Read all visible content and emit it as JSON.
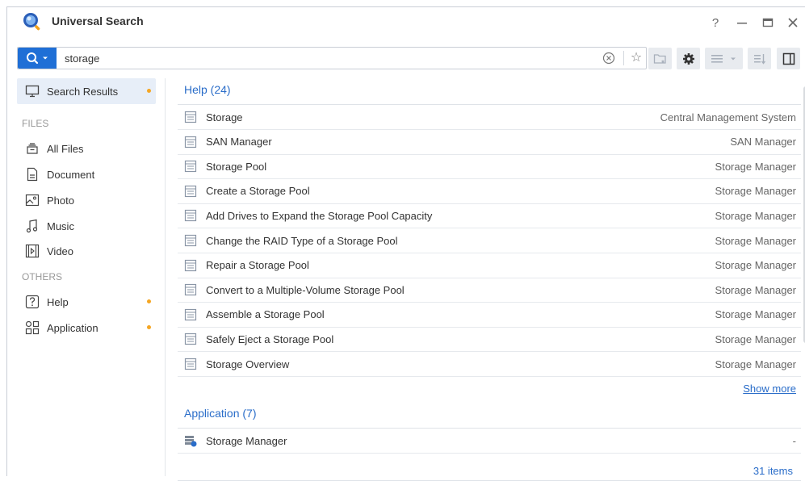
{
  "window": {
    "title": "Universal Search",
    "controls": [
      "help",
      "minimize",
      "maximize",
      "close"
    ],
    "help_glyph": "?"
  },
  "search": {
    "value": "storage",
    "placeholder": "",
    "button_icon": "search-icon"
  },
  "toolbar": {
    "buttons": [
      "folder-star-icon",
      "gear-icon",
      "list-view-icon",
      "sort-icon",
      "panel-toggle-icon"
    ]
  },
  "sidebar": {
    "active": "Search Results",
    "items": [
      {
        "label": "Search Results",
        "icon": "monitor-icon",
        "dot": true
      },
      {
        "label": "All Files",
        "icon": "files-icon",
        "dot": false
      },
      {
        "label": "Document",
        "icon": "document-icon",
        "dot": false
      },
      {
        "label": "Photo",
        "icon": "photo-icon",
        "dot": false
      },
      {
        "label": "Music",
        "icon": "music-icon",
        "dot": false
      },
      {
        "label": "Video",
        "icon": "video-icon",
        "dot": false
      },
      {
        "label": "Help",
        "icon": "help-icon",
        "dot": true
      },
      {
        "label": "Application",
        "icon": "apps-icon",
        "dot": true
      }
    ],
    "sections": {
      "files": "FILES",
      "others": "OTHERS"
    }
  },
  "results": {
    "help": {
      "title": "Help (24)",
      "rows": [
        {
          "name": "Storage",
          "source": "Central Management System"
        },
        {
          "name": "SAN Manager",
          "source": "SAN Manager"
        },
        {
          "name": "Storage Pool",
          "source": "Storage Manager"
        },
        {
          "name": "Create a Storage Pool",
          "source": "Storage Manager"
        },
        {
          "name": "Add Drives to Expand the Storage Pool Capacity",
          "source": "Storage Manager"
        },
        {
          "name": "Change the RAID Type of a Storage Pool",
          "source": "Storage Manager"
        },
        {
          "name": "Repair a Storage Pool",
          "source": "Storage Manager"
        },
        {
          "name": "Convert to a Multiple-Volume Storage Pool",
          "source": "Storage Manager"
        },
        {
          "name": "Assemble a Storage Pool",
          "source": "Storage Manager"
        },
        {
          "name": "Safely Eject a Storage Pool",
          "source": "Storage Manager"
        },
        {
          "name": "Storage Overview",
          "source": "Storage Manager"
        }
      ],
      "show_more": "Show more"
    },
    "application": {
      "title": "Application (7)",
      "rows": [
        {
          "name": "Storage Manager",
          "source": "-"
        }
      ]
    }
  },
  "status": {
    "count": "31 items"
  },
  "colors": {
    "accent": "#1f6fd6",
    "link": "#2a6dc9",
    "dot": "#f5a623",
    "active_bg": "#e7eef8"
  }
}
